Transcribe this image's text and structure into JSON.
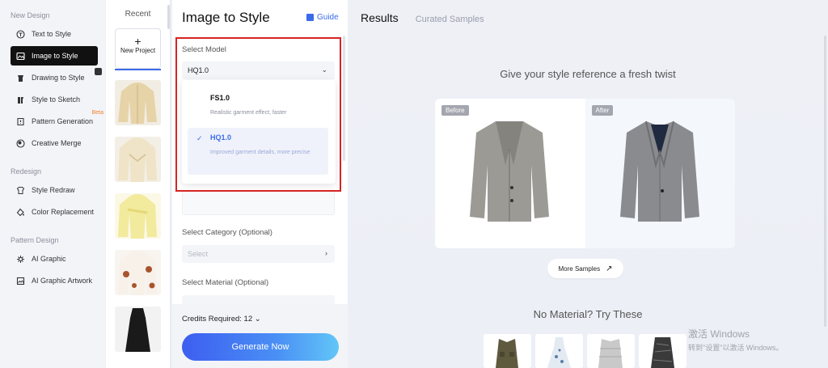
{
  "nav": {
    "sections": [
      {
        "title": "New Design",
        "items": [
          {
            "label": "Text to Style",
            "icon": "text-style-icon"
          },
          {
            "label": "Image to Style",
            "icon": "image-style-icon",
            "active": true
          },
          {
            "label": "Drawing to Style",
            "icon": "drawing-style-icon"
          },
          {
            "label": "Style to Sketch",
            "icon": "sketch-icon"
          },
          {
            "label": "Pattern Generation",
            "icon": "pattern-icon",
            "badge": "Beta"
          },
          {
            "label": "Creative Merge",
            "icon": "merge-icon"
          }
        ]
      },
      {
        "title": "Redesign",
        "items": [
          {
            "label": "Style Redraw",
            "icon": "redraw-icon"
          },
          {
            "label": "Color Replacement",
            "icon": "color-icon"
          }
        ]
      },
      {
        "title": "Pattern Design",
        "items": [
          {
            "label": "AI Graphic",
            "icon": "ai-graphic-icon"
          },
          {
            "label": "AI Graphic Artwork",
            "icon": "artwork-icon"
          }
        ]
      }
    ]
  },
  "recent": {
    "title": "Recent",
    "new_project": "New Project"
  },
  "form": {
    "title": "Image to Style",
    "guide": "Guide",
    "model_label": "Select Model",
    "model_value": "HQ1.0",
    "options": [
      {
        "name": "FS1.0",
        "desc": "Realistic garment effect, faster"
      },
      {
        "name": "HQ1.0",
        "desc": "Improved garment details, more precise",
        "selected": true
      }
    ],
    "category_label": "Select Category (Optional)",
    "category_placeholder": "Select",
    "material_label": "Select Material (Optional)",
    "credits": "Credits Required: 12",
    "generate": "Generate Now"
  },
  "results": {
    "tab_active": "Results",
    "tab_other": "Curated Samples",
    "heading": "Give your style reference a fresh twist",
    "before": "Before",
    "after": "After",
    "more_samples": "More Samples",
    "no_material": "No Material? Try These"
  },
  "watermark": {
    "line1": "激活 Windows",
    "line2": "转到\"设置\"以激活 Windows。"
  },
  "colors": {
    "accent": "#3a6be8",
    "highlight": "#d62424",
    "beta": "#f0802c"
  }
}
